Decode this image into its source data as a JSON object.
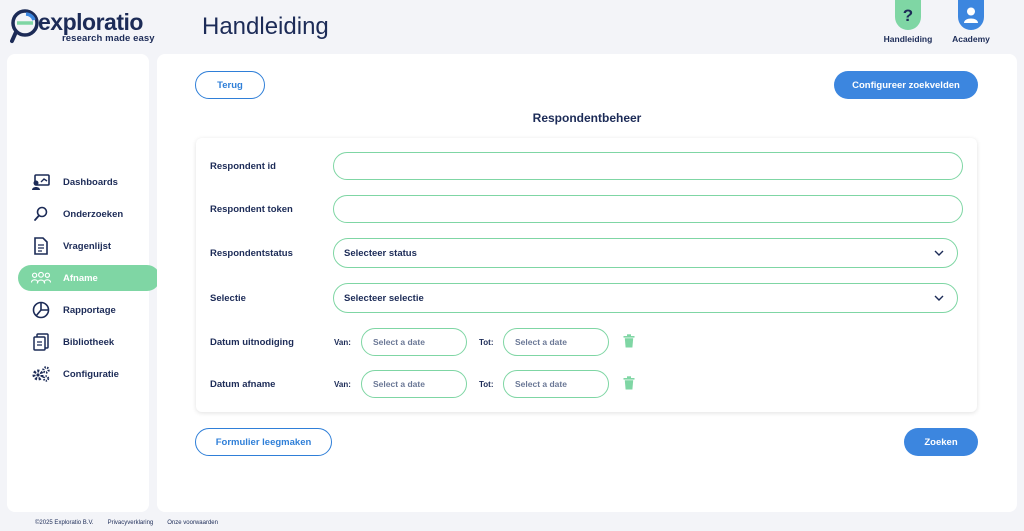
{
  "app": {
    "logo_name": "exploratio",
    "logo_tagline": "research made easy",
    "page_title": "Handleiding"
  },
  "topnav": [
    {
      "label": "Handleiding",
      "icon": "question-icon",
      "color": "#7fd6a4"
    },
    {
      "label": "Academy",
      "icon": "user-icon",
      "color": "#3c86df"
    }
  ],
  "sidebar": {
    "items": [
      {
        "label": "Dashboards",
        "icon": "dashboard-icon",
        "active": false
      },
      {
        "label": "Onderzoeken",
        "icon": "search-icon",
        "active": false
      },
      {
        "label": "Vragenlijst",
        "icon": "document-icon",
        "active": false
      },
      {
        "label": "Afname",
        "icon": "people-icon",
        "active": true
      },
      {
        "label": "Rapportage",
        "icon": "pie-chart-icon",
        "active": false
      },
      {
        "label": "Bibliotheek",
        "icon": "library-icon",
        "active": false
      },
      {
        "label": "Configuratie",
        "icon": "gears-icon",
        "active": false
      }
    ]
  },
  "main": {
    "back_label": "Terug",
    "configure_label": "Configureer zoekvelden",
    "section_title": "Respondentbeheer",
    "form": {
      "respondent_id_label": "Respondent id",
      "respondent_id_value": "",
      "respondent_token_label": "Respondent token",
      "respondent_token_value": "",
      "status_label": "Respondentstatus",
      "status_value": "Selecteer status",
      "selectie_label": "Selectie",
      "selectie_value": "Selecteer selectie",
      "date_rows": [
        {
          "label": "Datum uitnodiging",
          "from_label": "Van:",
          "to_label": "Tot:",
          "from_placeholder": "Select a date",
          "to_placeholder": "Select a date"
        },
        {
          "label": "Datum afname",
          "from_label": "Van:",
          "to_label": "Tot:",
          "from_placeholder": "Select a date",
          "to_placeholder": "Select a date"
        }
      ]
    },
    "clear_label": "Formulier leegmaken",
    "search_label": "Zoeken"
  },
  "footer": {
    "copyright": "©2025 Exploratio B.V.",
    "privacy": "Privacyverklaring",
    "terms": "Onze voorwaarden"
  },
  "colors": {
    "brand_navy": "#1c2b57",
    "accent_green": "#7fd6a4",
    "accent_blue": "#3c86df"
  }
}
